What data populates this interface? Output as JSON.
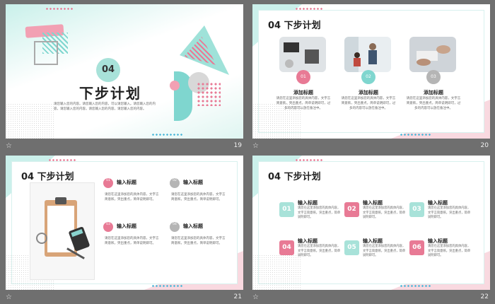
{
  "slides": [
    {
      "number": "19",
      "section_num": "04",
      "title": "下步计划",
      "body": "请您输入您的内容。请您输入您的内容，可以请您输入。请您输入您的内容，请您输入您的内容。请您输入您的内容，请您输入您的内容。"
    },
    {
      "number": "20",
      "title": "04 下步计划",
      "columns": [
        {
          "badge": "01",
          "head": "添加标题",
          "body": "请您在这里添加您的具体内容，文字言简意赅，突出重点，简单说明即可，过多的内容可以放在备注中。"
        },
        {
          "badge": "02",
          "head": "添加标题",
          "body": "请您在这里添加您的具体内容，文字言简意赅，突出重点，简单说明即可，过多的内容可以放在备注中。"
        },
        {
          "badge": "03",
          "head": "添加标题",
          "body": "请您在这里添加您的具体内容，文字言简意赅，突出重点，简单说明即可，过多的内容可以放在备注中。"
        }
      ]
    },
    {
      "number": "21",
      "title": "04 下步计划",
      "items": [
        {
          "badge": "01",
          "head": "输入标题",
          "body": "请您在这里添加您的具体内容，文字言简意赅，突出重点，简单说明即可。"
        },
        {
          "badge": "02",
          "head": "输入标题",
          "body": "请您在这里添加您的具体内容，文字言简意赅，突出重点，简单说明即可。"
        },
        {
          "badge": "03",
          "head": "输入标题",
          "body": "请您在这里添加您的具体内容，文字言简意赅，突出重点，简单说明即可。"
        },
        {
          "badge": "04",
          "head": "输入标题",
          "body": "请您在这里添加您的具体内容，文字言简意赅，突出重点，简单说明即可。"
        }
      ]
    },
    {
      "number": "22",
      "title": "04 下步计划",
      "items": [
        {
          "badge": "01",
          "head": "输入标题",
          "body": "请您在这里添加您的具体内容，文字言简意赅，突出重点，简单说明即可。"
        },
        {
          "badge": "02",
          "head": "输入标题",
          "body": "请您在这里添加您的具体内容，文字言简意赅，突出重点，简单说明即可。"
        },
        {
          "badge": "03",
          "head": "输入标题",
          "body": "请您在这里添加您的具体内容，文字言简意赅，突出重点，简单说明即可。"
        },
        {
          "badge": "04",
          "head": "输入标题",
          "body": "请您在这里添加您的具体内容，文字言简意赅，突出重点，简单说明即可。"
        },
        {
          "badge": "05",
          "head": "输入标题",
          "body": "请您在这里添加您的具体内容，文字言简意赅，突出重点，简单说明即可。"
        },
        {
          "badge": "06",
          "head": "输入标题",
          "body": "请您在这里添加您的具体内容，文字言简意赅，突出重点，简单说明即可。"
        }
      ]
    }
  ],
  "footer_icon": "star-icon",
  "colors": {
    "pink": "#e87a95",
    "teal": "#7fd6cf",
    "gray": "#b5b5b5"
  }
}
